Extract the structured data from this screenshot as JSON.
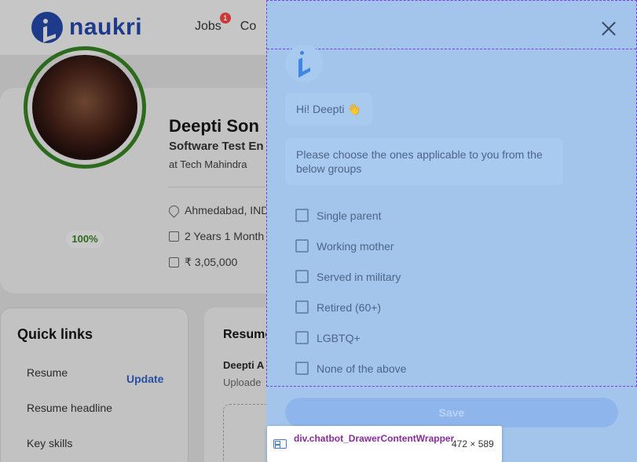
{
  "header": {
    "logo_text": "naukri",
    "nav": [
      {
        "label": "Jobs",
        "badge": "1"
      },
      {
        "label": "Co"
      }
    ]
  },
  "profile": {
    "name": "Deepti Son",
    "title": "Software Test En",
    "company": "at Tech Mahindra",
    "completion": "100%",
    "location": "Ahmedabad, IND",
    "experience": "2 Years 1 Month",
    "salary": "₹ 3,05,000"
  },
  "quick_links": {
    "title": "Quick links",
    "items": [
      "Resume",
      "Resume headline",
      "Key skills"
    ],
    "update_label": "Update"
  },
  "resume_card": {
    "title": "Resume",
    "name": "Deepti A",
    "upload": "Uploade"
  },
  "drawer": {
    "greeting": "Hi! Deepti 👋",
    "prompt": "Please choose the ones applicable to you from the below groups",
    "options": [
      "Single parent",
      "Working mother",
      "Served in military",
      "Retired (60+)",
      "LGBTQ+",
      "None of the above"
    ],
    "save_label": "Save",
    "colors": {
      "background": "#a3c5ec",
      "accent": "#3f86e8"
    }
  },
  "devtools_tooltip": {
    "element_name": "div.chatbot_DrawerContentWrapper",
    "size": "472 × 589"
  }
}
